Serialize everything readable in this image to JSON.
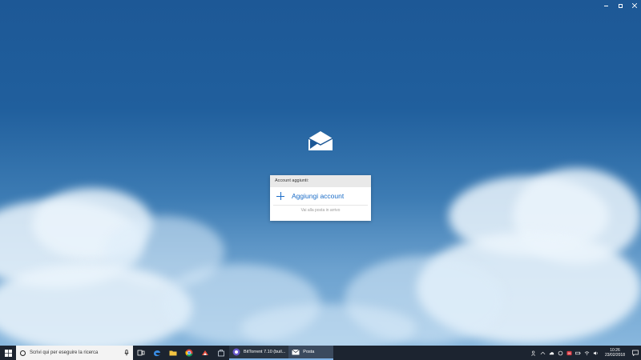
{
  "window": {
    "controls": {
      "minimize_icon": "minimize-icon",
      "maximize_icon": "restore-icon",
      "close_icon": "close-icon"
    }
  },
  "app": {
    "logo_icon": "mail-envelope-icon"
  },
  "account_panel": {
    "header": "Account aggiunti:",
    "add_account": "Aggiungi account",
    "inbox_link": "Vai alla posta in arrivo"
  },
  "taskbar": {
    "search_placeholder": "Scrivi qui per eseguire la ricerca",
    "tasks": [
      {
        "label": "BitTorrent 7.10  (buil...",
        "icon": "bittorrent-icon"
      },
      {
        "label": "Posta",
        "icon": "mail-icon"
      }
    ],
    "clock": {
      "time": "10:26",
      "date": "23/02/2018"
    },
    "notification_badge": "99"
  },
  "colors": {
    "accent": "#1a6cc7",
    "taskbar": "#1c2430",
    "desktop_blue": "#1d5896"
  }
}
